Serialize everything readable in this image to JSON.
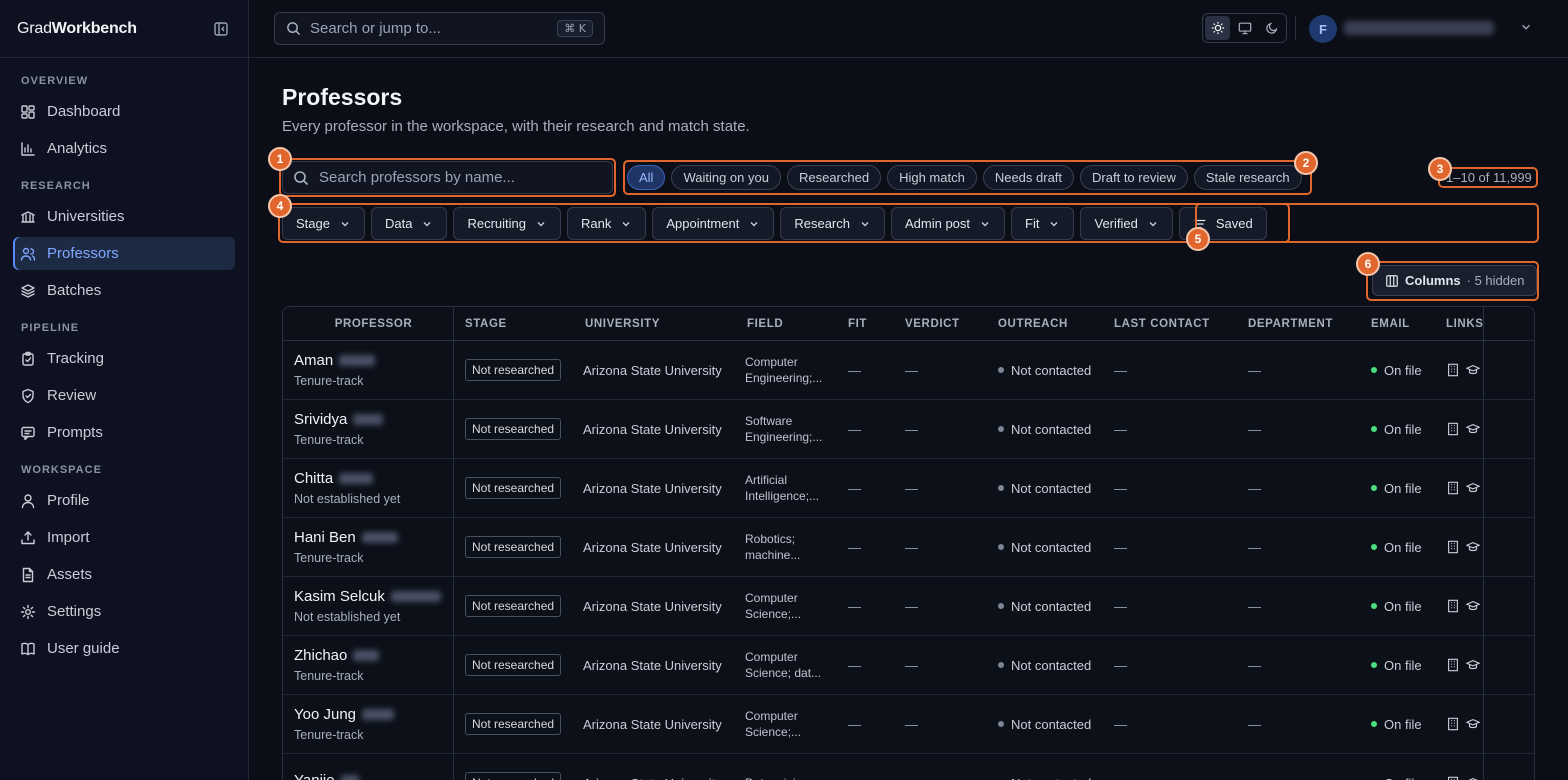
{
  "brand": {
    "prefix": "Grad",
    "bold": "Workbench"
  },
  "sidebar": {
    "sections": [
      {
        "title": "OVERVIEW",
        "items": [
          {
            "label": "Dashboard",
            "icon": "dashboard-icon"
          },
          {
            "label": "Analytics",
            "icon": "analytics-icon"
          }
        ]
      },
      {
        "title": "RESEARCH",
        "items": [
          {
            "label": "Universities",
            "icon": "university-icon"
          },
          {
            "label": "Professors",
            "icon": "users-icon",
            "active": true
          },
          {
            "label": "Batches",
            "icon": "layers-icon"
          }
        ]
      },
      {
        "title": "PIPELINE",
        "items": [
          {
            "label": "Tracking",
            "icon": "clipboard-icon"
          },
          {
            "label": "Review",
            "icon": "shield-icon"
          },
          {
            "label": "Prompts",
            "icon": "message-icon"
          }
        ]
      },
      {
        "title": "WORKSPACE",
        "items": [
          {
            "label": "Profile",
            "icon": "user-icon"
          },
          {
            "label": "Import",
            "icon": "upload-icon"
          },
          {
            "label": "Assets",
            "icon": "file-icon"
          },
          {
            "label": "Settings",
            "icon": "gear-icon"
          },
          {
            "label": "User guide",
            "icon": "book-icon"
          }
        ]
      }
    ]
  },
  "topbar": {
    "search_placeholder": "Search or jump to...",
    "shortcut": "⌘ K",
    "avatar_initial": "F"
  },
  "page": {
    "title": "Professors",
    "subtitle": "Every professor in the workspace, with their research and match state.",
    "search_placeholder": "Search professors by name...",
    "chips": [
      "All",
      "Waiting on you",
      "Researched",
      "High match",
      "Needs draft",
      "Draft to review",
      "Stale research"
    ],
    "active_chip": "All",
    "count": "1–10 of 11,999",
    "filters": [
      "Stage",
      "Data",
      "Recruiting",
      "Rank",
      "Appointment",
      "Research",
      "Admin post",
      "Fit",
      "Verified"
    ],
    "saved_label": "Saved",
    "columns_label": "Columns",
    "columns_hidden": "· 5 hidden"
  },
  "annotations": [
    "1",
    "2",
    "3",
    "4",
    "5",
    "6"
  ],
  "table": {
    "headers": {
      "professor": "PROFESSOR",
      "stage": "STAGE",
      "university": "UNIVERSITY",
      "field": "FIELD",
      "fit": "FIT",
      "verdict": "VERDICT",
      "outreach": "OUTREACH",
      "last_contact": "LAST CONTACT",
      "department": "DEPARTMENT",
      "email": "EMAIL",
      "links": "LINKS"
    },
    "rows": [
      {
        "name": "Aman",
        "track": "Tenure-track",
        "stage": "Not researched",
        "university": "Arizona State University",
        "field": "Computer\nEngineering;...",
        "fit": "—",
        "verdict": "—",
        "outreach": "Not contacted",
        "last_contact": "—",
        "department": "—",
        "email": "On file"
      },
      {
        "name": "Srividya",
        "track": "Tenure-track",
        "stage": "Not researched",
        "university": "Arizona State University",
        "field": "Software\nEngineering;...",
        "fit": "—",
        "verdict": "—",
        "outreach": "Not contacted",
        "last_contact": "—",
        "department": "—",
        "email": "On file"
      },
      {
        "name": "Chitta",
        "track": "Not established yet",
        "stage": "Not researched",
        "university": "Arizona State University",
        "field": "Artificial\nIntelligence;...",
        "fit": "—",
        "verdict": "—",
        "outreach": "Not contacted",
        "last_contact": "—",
        "department": "—",
        "email": "On file"
      },
      {
        "name": "Hani Ben",
        "track": "Tenure-track",
        "stage": "Not researched",
        "university": "Arizona State University",
        "field": "Robotics;\nmachine...",
        "fit": "—",
        "verdict": "—",
        "outreach": "Not contacted",
        "last_contact": "—",
        "department": "—",
        "email": "On file"
      },
      {
        "name": "Kasim Selcuk",
        "track": "Not established yet",
        "stage": "Not researched",
        "university": "Arizona State University",
        "field": "Computer\nScience;...",
        "fit": "—",
        "verdict": "—",
        "outreach": "Not contacted",
        "last_contact": "—",
        "department": "—",
        "email": "On file"
      },
      {
        "name": "Zhichao",
        "track": "Tenure-track",
        "stage": "Not researched",
        "university": "Arizona State University",
        "field": "Computer\nScience; dat...",
        "fit": "—",
        "verdict": "—",
        "outreach": "Not contacted",
        "last_contact": "—",
        "department": "—",
        "email": "On file"
      },
      {
        "name": "Yoo Jung",
        "track": "Tenure-track",
        "stage": "Not researched",
        "university": "Arizona State University",
        "field": "Computer\nScience;...",
        "fit": "—",
        "verdict": "—",
        "outreach": "Not contacted",
        "last_contact": "—",
        "department": "—",
        "email": "On file"
      },
      {
        "name": "Yanjie",
        "track": "",
        "stage": "Not researched",
        "university": "Arizona State University",
        "field": "Data mining;\n",
        "fit": "—",
        "verdict": "—",
        "outreach": "Not contacted",
        "last_contact": "—",
        "department": "—",
        "email": "On file"
      }
    ]
  },
  "colors": {
    "accent": "#5b8cff",
    "annotation": "#e0662e",
    "on_file": "#4ade80"
  }
}
